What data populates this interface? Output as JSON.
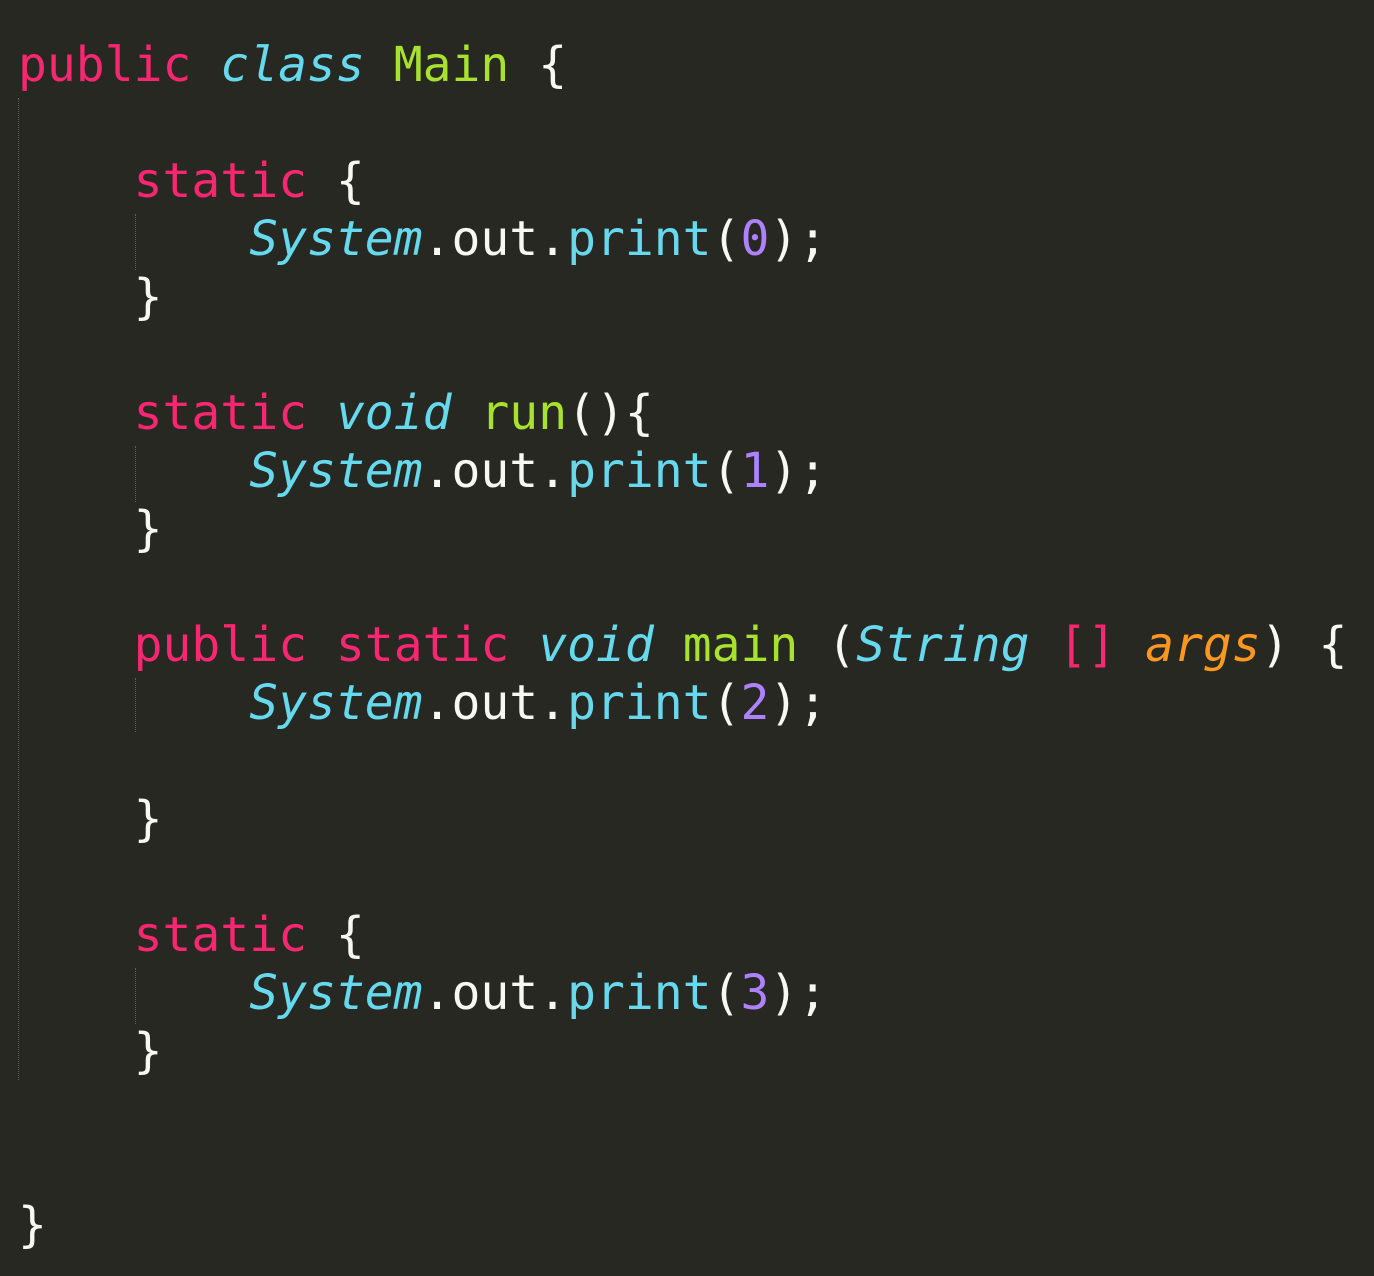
{
  "colors": {
    "background": "#272822",
    "default": "#f8f8f2",
    "keyword": "#f92672",
    "type": "#66d9ef",
    "function": "#a6e22e",
    "number": "#ae81ff",
    "parameter": "#fd971f",
    "indent_guide": "#5f5f55"
  },
  "code": [
    {
      "tokens": [
        {
          "t": "public",
          "k": "kw"
        },
        {
          "t": " ",
          "k": "punct"
        },
        {
          "t": "class",
          "k": "kwi"
        },
        {
          "t": " ",
          "k": "punct"
        },
        {
          "t": "Main",
          "k": "cls"
        },
        {
          "t": " {",
          "k": "punct"
        }
      ]
    },
    {
      "tokens": []
    },
    {
      "tokens": [
        {
          "t": "    ",
          "k": "punct"
        },
        {
          "t": "static",
          "k": "kw"
        },
        {
          "t": " {",
          "k": "punct"
        }
      ]
    },
    {
      "tokens": [
        {
          "t": "        ",
          "k": "punct"
        },
        {
          "t": "System",
          "k": "obj"
        },
        {
          "t": ".out.",
          "k": "id"
        },
        {
          "t": "print",
          "k": "call"
        },
        {
          "t": "(",
          "k": "punct"
        },
        {
          "t": "0",
          "k": "num"
        },
        {
          "t": ");",
          "k": "punct"
        }
      ]
    },
    {
      "tokens": [
        {
          "t": "    }",
          "k": "punct"
        }
      ]
    },
    {
      "tokens": []
    },
    {
      "tokens": [
        {
          "t": "    ",
          "k": "punct"
        },
        {
          "t": "static",
          "k": "kw"
        },
        {
          "t": " ",
          "k": "punct"
        },
        {
          "t": "void",
          "k": "kwi"
        },
        {
          "t": " ",
          "k": "punct"
        },
        {
          "t": "run",
          "k": "fn"
        },
        {
          "t": "(){",
          "k": "punct"
        }
      ]
    },
    {
      "tokens": [
        {
          "t": "        ",
          "k": "punct"
        },
        {
          "t": "System",
          "k": "obj"
        },
        {
          "t": ".out.",
          "k": "id"
        },
        {
          "t": "print",
          "k": "call"
        },
        {
          "t": "(",
          "k": "punct"
        },
        {
          "t": "1",
          "k": "num"
        },
        {
          "t": ");",
          "k": "punct"
        }
      ]
    },
    {
      "tokens": [
        {
          "t": "    }",
          "k": "punct"
        }
      ]
    },
    {
      "tokens": []
    },
    {
      "tokens": [
        {
          "t": "    ",
          "k": "punct"
        },
        {
          "t": "public",
          "k": "kw"
        },
        {
          "t": " ",
          "k": "punct"
        },
        {
          "t": "static",
          "k": "kw"
        },
        {
          "t": " ",
          "k": "punct"
        },
        {
          "t": "void",
          "k": "kwi"
        },
        {
          "t": " ",
          "k": "punct"
        },
        {
          "t": "main",
          "k": "fn"
        },
        {
          "t": " (",
          "k": "punct"
        },
        {
          "t": "String",
          "k": "obj"
        },
        {
          "t": " ",
          "k": "punct"
        },
        {
          "t": "[]",
          "k": "kw"
        },
        {
          "t": " ",
          "k": "punct"
        },
        {
          "t": "args",
          "k": "param"
        },
        {
          "t": ") {",
          "k": "punct"
        }
      ]
    },
    {
      "tokens": [
        {
          "t": "        ",
          "k": "punct"
        },
        {
          "t": "System",
          "k": "obj"
        },
        {
          "t": ".out.",
          "k": "id"
        },
        {
          "t": "print",
          "k": "call"
        },
        {
          "t": "(",
          "k": "punct"
        },
        {
          "t": "2",
          "k": "num"
        },
        {
          "t": ");",
          "k": "punct"
        }
      ]
    },
    {
      "tokens": []
    },
    {
      "tokens": [
        {
          "t": "    }",
          "k": "punct"
        }
      ]
    },
    {
      "tokens": []
    },
    {
      "tokens": [
        {
          "t": "    ",
          "k": "punct"
        },
        {
          "t": "static",
          "k": "kw"
        },
        {
          "t": " {",
          "k": "punct"
        }
      ]
    },
    {
      "tokens": [
        {
          "t": "        ",
          "k": "punct"
        },
        {
          "t": "System",
          "k": "obj"
        },
        {
          "t": ".out.",
          "k": "id"
        },
        {
          "t": "print",
          "k": "call"
        },
        {
          "t": "(",
          "k": "punct"
        },
        {
          "t": "3",
          "k": "num"
        },
        {
          "t": ");",
          "k": "punct"
        }
      ]
    },
    {
      "tokens": [
        {
          "t": "    }",
          "k": "punct"
        }
      ]
    },
    {
      "tokens": []
    },
    {
      "tokens": []
    },
    {
      "tokens": [
        {
          "t": "}",
          "k": "punct"
        }
      ]
    }
  ]
}
